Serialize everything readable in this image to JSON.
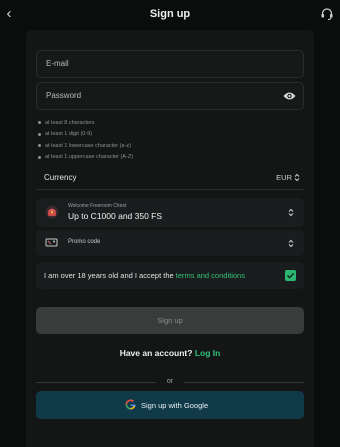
{
  "header": {
    "back_glyph": "‹",
    "title": "Sign up",
    "support_icon": "headset-icon"
  },
  "form": {
    "email_label": "E-mail",
    "password_label": "Password",
    "password_rules": [
      "at least 8 characters",
      "at least 1 digit (0-9)",
      "at least 1 lowercase character (a-z)",
      "at least 1 uppercase character (A-Z)"
    ],
    "currency_label": "Currency",
    "currency_value": "EUR",
    "bonus_caption": "Welcome Freeroom Chest",
    "bonus_title": "Up to C1000 and 350 FS",
    "promo_label": "Promo code",
    "terms_text": "I am over 18 years old and I accept the ",
    "terms_link": "terms and conditions",
    "terms_checked": true,
    "submit_label": "Sign up"
  },
  "footer": {
    "have_account": "Have an account?",
    "login_link": "Log In",
    "or_label": "or",
    "google_label": "Sign up with Google"
  },
  "colors": {
    "background": "#0b0d0d",
    "panel": "#141616",
    "accent_green": "#2cb872",
    "google_button": "#113a49",
    "disabled_button": "#3a3c3c"
  }
}
